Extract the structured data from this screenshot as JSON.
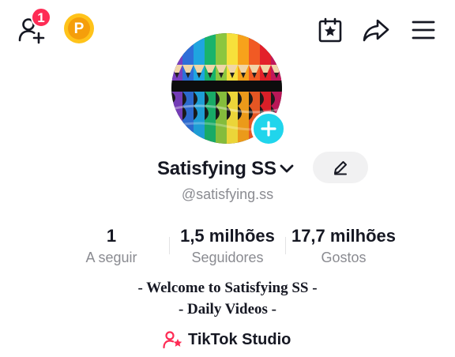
{
  "topbar": {
    "notification_count": "1",
    "coin_letter": "P"
  },
  "profile": {
    "display_name": "Satisfying SS",
    "handle": "@satisfying.ss"
  },
  "stats": [
    {
      "value": "1",
      "label": "A seguir"
    },
    {
      "value": "1,5 milhões",
      "label": "Seguidores"
    },
    {
      "value": "17,7 milhões",
      "label": "Gostos"
    }
  ],
  "bio": {
    "line1": "- Welcome to Satisfying SS -",
    "line2": "- Daily Videos -"
  },
  "studio": {
    "label": "TikTok Studio"
  },
  "colors": {
    "badge": "#fe2c55",
    "coin": "#ffc31a",
    "add_avatar": "#20d5ec",
    "muted_text": "#8a8b91"
  },
  "icons": [
    "add-friend-icon",
    "coin-icon",
    "calendar-star-icon",
    "share-icon",
    "menu-icon",
    "plus-icon",
    "chevron-down-icon",
    "pencil-icon",
    "studio-person-star-icon"
  ]
}
